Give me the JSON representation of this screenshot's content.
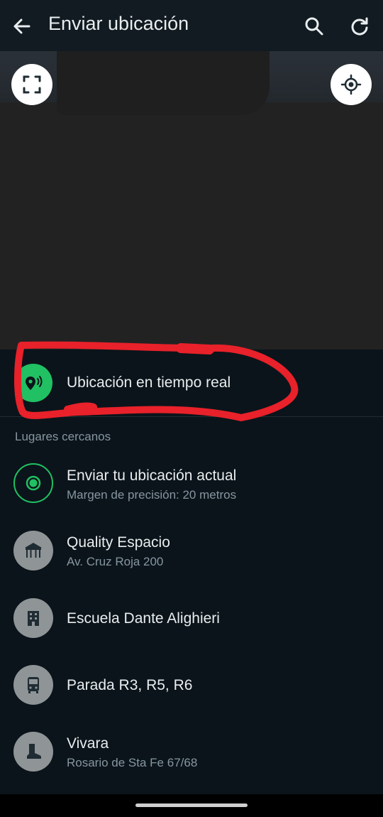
{
  "app_bar": {
    "title": "Enviar ubicación",
    "back_icon": "arrow-left-icon",
    "search_icon": "search-icon",
    "refresh_icon": "refresh-icon"
  },
  "map": {
    "expand_icon": "fullscreen-icon",
    "locate_icon": "my-location-icon"
  },
  "live_location": {
    "label": "Ubicación en tiempo real",
    "icon": "live-location-icon",
    "icon_color": "#21c063",
    "annotation_color": "#e8212a"
  },
  "nearby": {
    "section_title": "Lugares cercanos",
    "items": [
      {
        "name": "Enviar tu ubicación actual",
        "sub": "Margen de precisión: 20 metros",
        "icon": "current-location-icon"
      },
      {
        "name": "Quality Espacio",
        "sub": "Av. Cruz Roja 200",
        "icon": "pavilion-icon"
      },
      {
        "name": "Escuela Dante Alighieri",
        "sub": "",
        "icon": "building-icon"
      },
      {
        "name": "Parada R3, R5, R6",
        "sub": "",
        "icon": "bus-icon"
      },
      {
        "name": "Vivara",
        "sub": "Rosario de Sta Fe 67/68",
        "icon": "boot-icon"
      }
    ]
  },
  "colors": {
    "background": "#0b141a",
    "accent": "#21c063",
    "secondary_text": "#8696a0"
  }
}
